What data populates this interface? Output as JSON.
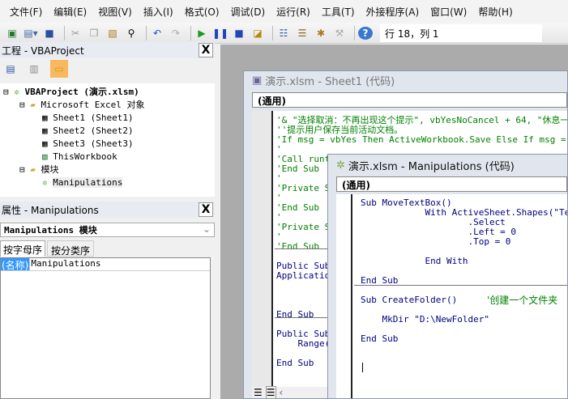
{
  "menu": [
    "文件(F)",
    "编辑(E)",
    "视图(V)",
    "插入(I)",
    "格式(O)",
    "调试(D)",
    "运行(R)",
    "工具(T)",
    "外接程序(A)",
    "窗口(W)",
    "帮助(H)"
  ],
  "toolbar": {
    "position": "行 18，列 1"
  },
  "project": {
    "title": "工程 - VBAProject",
    "root": "VBAProject (演示.xlsm)",
    "folder1": "Microsoft Excel 对象",
    "items": [
      "Sheet1 (Sheet1)",
      "Sheet2 (Sheet2)",
      "Sheet3 (Sheet3)",
      "ThisWorkbook"
    ],
    "folder2": "模块",
    "module": "Manipulations",
    "close": "X"
  },
  "properties": {
    "title": "属性 - Manipulations",
    "object": "Manipulations 模块",
    "tabs": [
      "按字母序",
      "按分类序"
    ],
    "name_key": "(名称)",
    "name_value": "Manipulations",
    "close": "X"
  },
  "sheet1": {
    "title": "演示.xlsm - Sheet1 (代码)",
    "combo": "(通用)",
    "lines": [
      {
        "t": "'& \"选择取消：不再出现这个提示\", vbYesNoCancel + 64, \"休息一",
        "c": 1
      },
      {
        "t": "''提示用户保存当前活动文档。",
        "c": 1
      },
      {
        "t": "'If msg = vbYes Then ActiveWorkbook.Save Else If msg = vbCan",
        "c": 1
      },
      {
        "t": "'",
        "c": 1
      },
      {
        "t": "'Call runt",
        "c": 1
      },
      {
        "t": "'End Sub",
        "c": 1
      },
      {
        "t": "'",
        "c": 1
      },
      {
        "t": "'Private Su",
        "c": 1
      },
      {
        "t": "'",
        "c": 1
      },
      {
        "t": "'End Sub",
        "c": 1
      },
      {
        "t": "'",
        "c": 1
      },
      {
        "t": "'Private Su",
        "c": 1
      },
      {
        "t": "'",
        "c": 1
      },
      {
        "t": "'End Sub",
        "c": 1
      },
      {
        "t": "",
        "c": 0
      },
      {
        "t": "Public Sub",
        "c": 0
      },
      {
        "t": "Application",
        "c": 0
      },
      {
        "t": "",
        "c": 0
      },
      {
        "t": "",
        "c": 0
      },
      {
        "t": "",
        "c": 0
      },
      {
        "t": "End Sub",
        "c": 0
      },
      {
        "t": "",
        "c": 0
      },
      {
        "t": "Public Sub",
        "c": 0
      },
      {
        "t": "    Range(",
        "c": 0
      },
      {
        "t": "",
        "c": 0
      },
      {
        "t": "End Sub",
        "c": 0
      }
    ]
  },
  "manip": {
    "title": "演示.xlsm - Manipulations (代码)",
    "combo": "(通用)",
    "lines": [
      {
        "t": "Sub MoveTextBox()",
        "y": 0
      },
      {
        "t": "            With ActiveSheet.Shapes(\"Text",
        "y": 1
      },
      {
        "t": "                    .Select",
        "y": 2
      },
      {
        "t": "                    .Left = 0",
        "y": 3
      },
      {
        "t": "                    .Top = 0",
        "y": 4
      },
      {
        "t": "            End With",
        "y": 6
      },
      {
        "t": "End Sub",
        "y": 8
      },
      {
        "t": "Sub CreateFolder()",
        "y": 10
      },
      {
        "t": "    MkDir \"D:\\NewFolder\"",
        "y": 12
      },
      {
        "t": "End Sub",
        "y": 14
      }
    ],
    "comment": "'创建一个文件夹"
  }
}
